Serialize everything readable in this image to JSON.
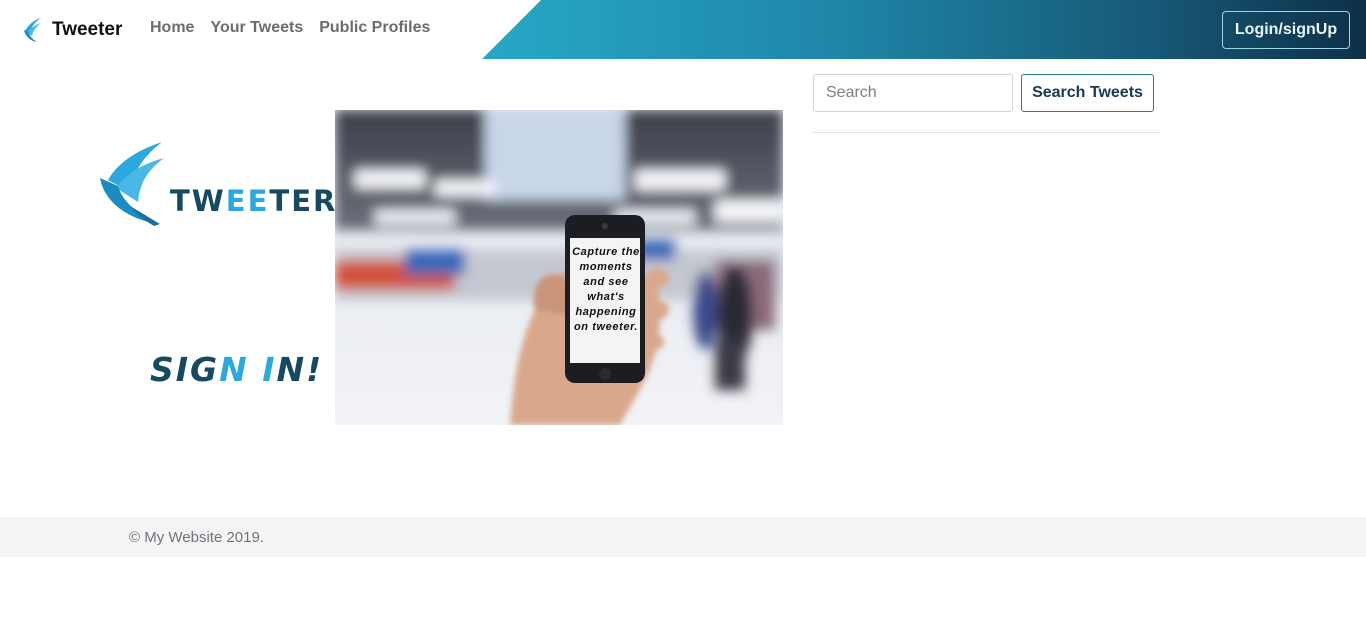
{
  "navbar": {
    "brand": "Tweeter",
    "links": [
      "Home",
      "Your Tweets",
      "Public Profiles"
    ],
    "login_label": "Login/signUp",
    "gradient_colors": [
      "#27a8c8",
      "#0e3048"
    ]
  },
  "hero": {
    "logo_text_dark_1": "TW",
    "logo_text_light": "EE",
    "logo_text_dark_2": "TER",
    "sign_in_parts": [
      "SIG",
      "N",
      " ",
      "I",
      "N!"
    ],
    "phone_caption": "Capture the moments and see what's happening on tweeter."
  },
  "search": {
    "placeholder": "Search",
    "button_label": "Search Tweets"
  },
  "footer": {
    "text": "© My Website 2019."
  },
  "colors": {
    "brand_dark": "#164a62",
    "brand_light": "#2aa8e0"
  }
}
